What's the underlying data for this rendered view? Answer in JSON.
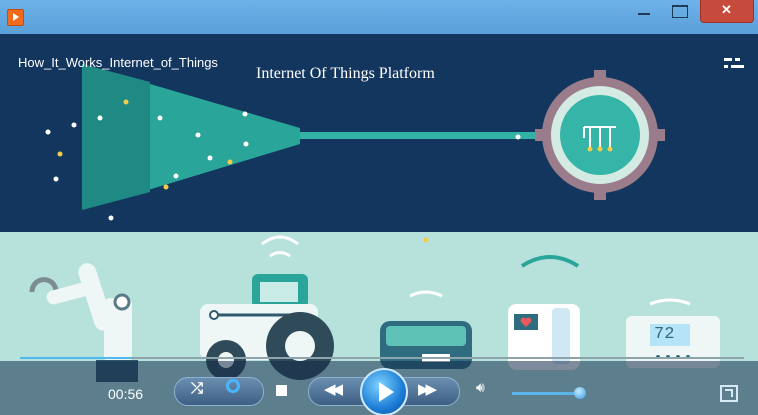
{
  "window": {
    "title_icon": "media-player-icon"
  },
  "video": {
    "filename": "How_It_Works_Internet_of_Things",
    "overlay_title": "Internet Of Things Platform",
    "thermostat_value": "72"
  },
  "controls": {
    "current_time": "00:56",
    "seek_progress_fraction": 0.155,
    "volume_fraction": 0.9,
    "accent_color": "#52b8f0"
  }
}
